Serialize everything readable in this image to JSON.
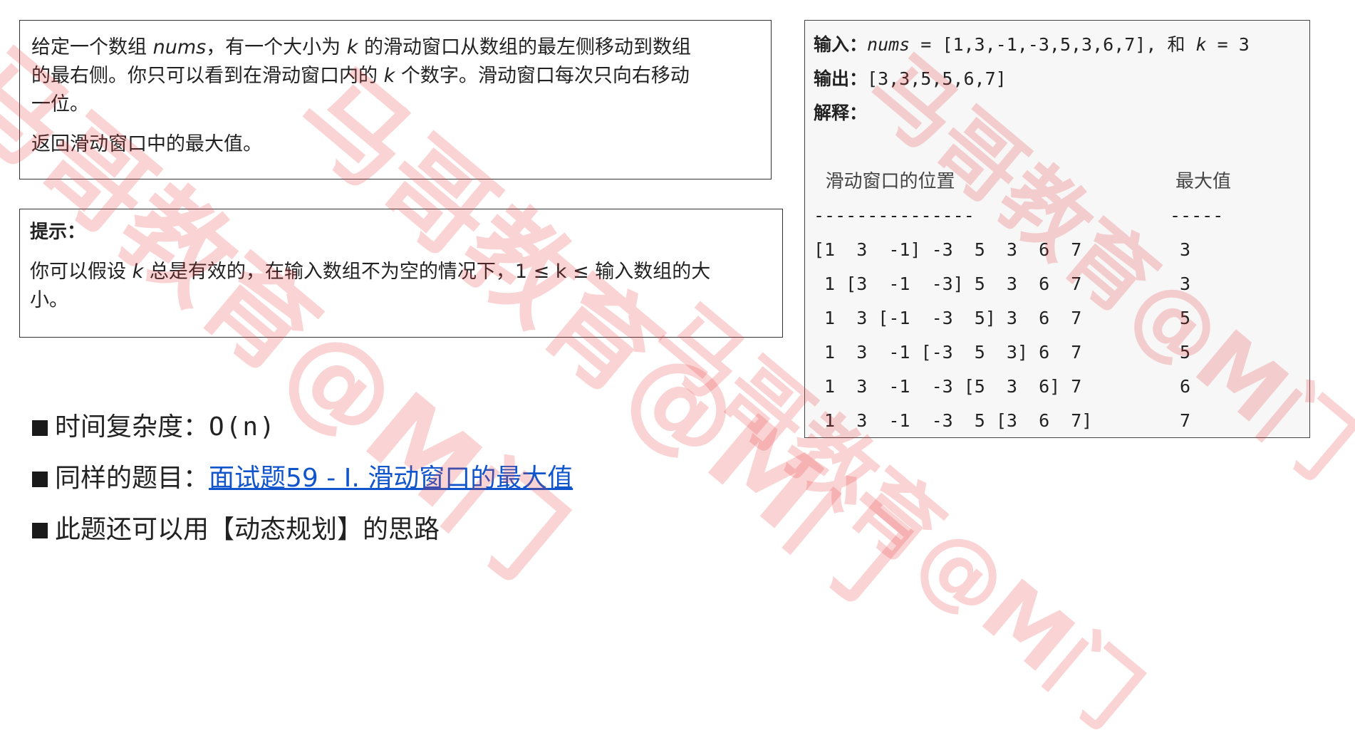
{
  "watermark": {
    "text": "马哥教育@M门"
  },
  "description": {
    "para1_lines": [
      [
        "给定一个数组 ",
        "nums",
        "，有一个大小为 ",
        "k",
        " 的滑动窗口从数组的最左侧移动到数组"
      ],
      [
        "的最右侧。你只可以看到在滑动窗口内的 ",
        "k",
        " 个数字。滑动窗口每次只向右移动"
      ],
      [
        "一位。"
      ]
    ],
    "para2": "返回滑动窗口中的最大值。"
  },
  "hint": {
    "title": "提示：",
    "line1_a": "你可以假设 ",
    "line1_k": "k",
    "line1_b": " 总是有效的，在输入数组不为空的情况下，1 ≤ k ≤ 输入数组的大",
    "line2": "小。"
  },
  "example": {
    "input_label": "输入：",
    "input_var": "nums",
    "input_value": " = [1,3,-1,-3,5,3,6,7], ",
    "input_and": "和",
    "input_k": "k",
    "input_k_value": " = 3",
    "output_label": "输出：",
    "output_value": "[3,3,5,5,6,7]",
    "explain_label": "解释：",
    "col_window": "  滑动窗口的位置",
    "col_max": "最大值",
    "dash_left": "---------------",
    "dash_right": "-----",
    "rows": [
      {
        "window": "[1  3  -1] -3  5  3  6  7",
        "max": "3"
      },
      {
        "window": " 1 [3  -1  -3] 5  3  6  7",
        "max": "3"
      },
      {
        "window": " 1  3 [-1  -3  5] 3  6  7",
        "max": "5"
      },
      {
        "window": " 1  3  -1 [-3  5  3] 6  7",
        "max": "5"
      },
      {
        "window": " 1  3  -1  -3 [5  3  6] 7",
        "max": "6"
      },
      {
        "window": " 1  3  -1  -3  5 [3  6  7]",
        "max": "7"
      }
    ]
  },
  "bullets": {
    "complexity_label": "时间复杂度：",
    "complexity_value": "O(n)",
    "same_label": "同样的题目：",
    "same_link": "面试题59 - I. 滑动窗口的最大值",
    "dp_text": "此题还可以用【动态规划】的思路"
  },
  "colors": {
    "link": "#1155cc",
    "watermark": "#e63c3c"
  }
}
